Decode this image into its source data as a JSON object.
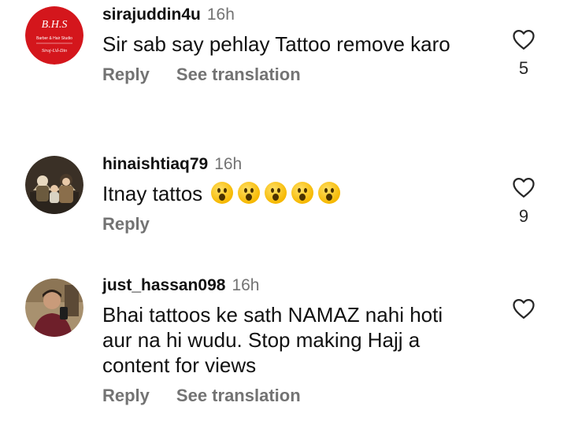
{
  "comments": [
    {
      "username": "sirajuddin4u",
      "time": "16h",
      "text": "Sir sab say pehlay Tattoo remove karo",
      "reply_label": "Reply",
      "translate_label": "See translation",
      "likes": "5",
      "avatar": {
        "logo_title": "B.H.S",
        "logo_line1": "Barber & Hair Studio",
        "logo_line2": "Siraj-Ud-Din",
        "bg_color": "#d4161c"
      }
    },
    {
      "username": "hinaishtiaq79",
      "time": "16h",
      "text": "Itnay tattos",
      "emoji_count": 5,
      "reply_label": "Reply",
      "likes": "9"
    },
    {
      "username": "just_hassan098",
      "time": "16h",
      "text": "Bhai tattoos ke sath NAMAZ nahi hoti aur na hi wudu. Stop making Hajj a content for views",
      "reply_label": "Reply",
      "translate_label": "See translation"
    }
  ],
  "icons": {
    "like": "heart-outline-icon"
  }
}
